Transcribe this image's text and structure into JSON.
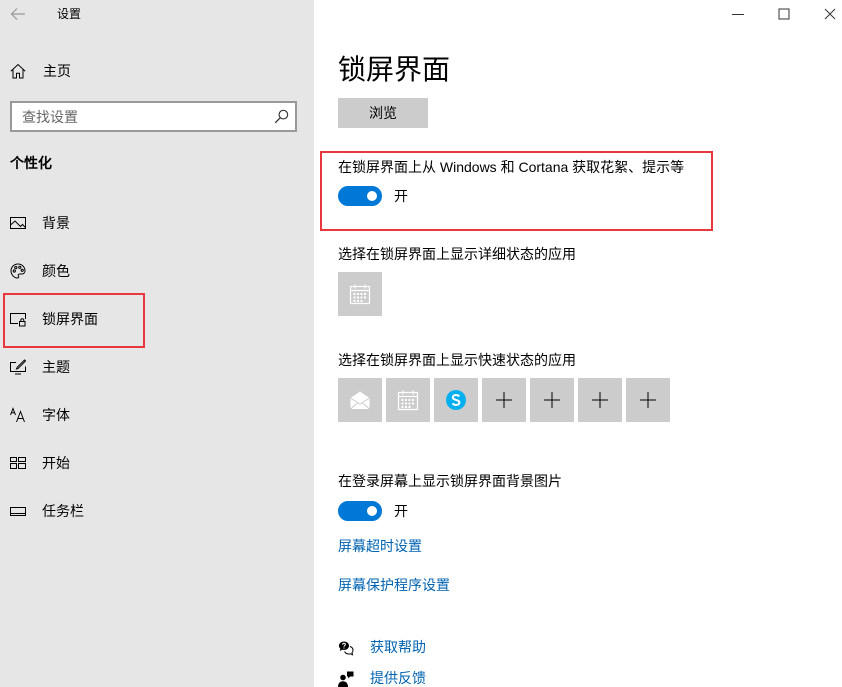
{
  "window": {
    "title": "设置",
    "back_icon": "back-arrow-icon",
    "controls": [
      "minimize-icon",
      "maximize-icon",
      "close-icon"
    ]
  },
  "sidebar": {
    "home": {
      "label": "主页",
      "icon": "home-icon"
    },
    "search": {
      "placeholder": "查找设置",
      "icon": "search-icon"
    },
    "section_title": "个性化",
    "items": [
      {
        "label": "背景",
        "icon": "picture-icon"
      },
      {
        "label": "颜色",
        "icon": "palette-icon"
      },
      {
        "label": "锁屏界面",
        "icon": "lock-screen-icon",
        "selected": true
      },
      {
        "label": "主题",
        "icon": "theme-icon"
      },
      {
        "label": "字体",
        "icon": "font-icon"
      },
      {
        "label": "开始",
        "icon": "start-icon"
      },
      {
        "label": "任务栏",
        "icon": "taskbar-icon"
      }
    ]
  },
  "main": {
    "title": "锁屏界面",
    "browse_button": "浏览",
    "spotlight_toggle": {
      "label": "在锁屏界面上从 Windows 和 Cortana 获取花絮、提示等",
      "state_label": "开",
      "on": true
    },
    "detailed_status": {
      "label": "选择在锁屏界面上显示详细状态的应用",
      "apps": [
        "calendar-icon"
      ]
    },
    "quick_status": {
      "label": "选择在锁屏界面上显示快速状态的应用",
      "apps": [
        "mail-icon",
        "calendar-icon",
        "skype-icon",
        "plus-icon",
        "plus-icon",
        "plus-icon",
        "plus-icon"
      ]
    },
    "signin_background_toggle": {
      "label": "在登录屏幕上显示锁屏界面背景图片",
      "state_label": "开",
      "on": true
    },
    "links": {
      "screen_timeout": "屏幕超时设置",
      "screen_saver": "屏幕保护程序设置"
    },
    "help": {
      "get_help": {
        "label": "获取帮助",
        "icon": "help-chat-icon"
      },
      "feedback": {
        "label": "提供反馈",
        "icon": "feedback-icon"
      }
    }
  },
  "colors": {
    "accent": "#0078d7",
    "link": "#0063b1",
    "highlight": "#e8383d",
    "sidebar_bg": "#e6e6e6",
    "tile_bg": "#cccccc",
    "skype": "#00aff0"
  }
}
